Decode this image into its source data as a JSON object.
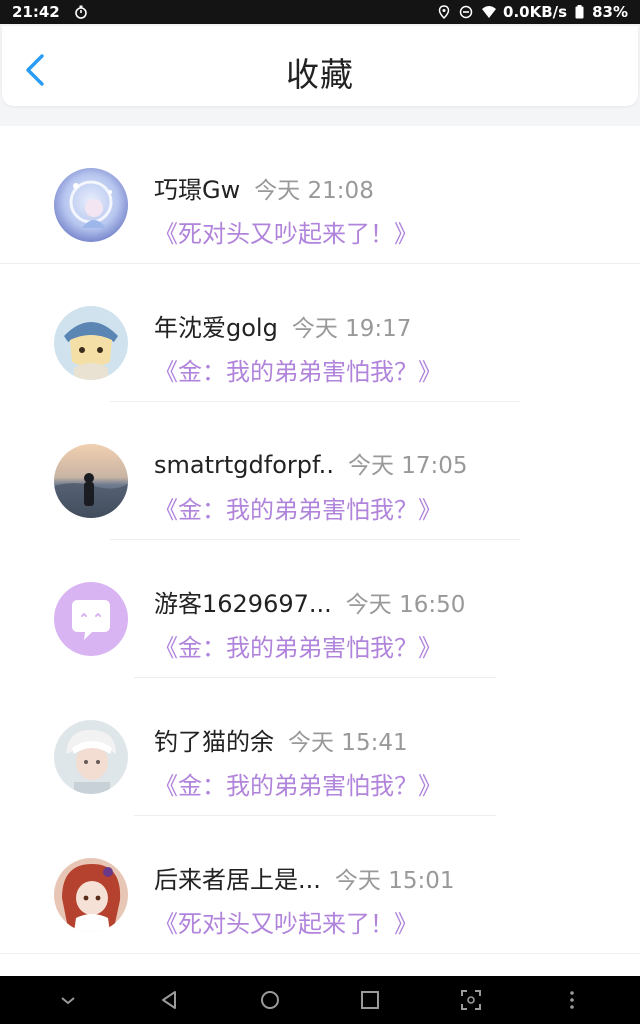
{
  "status_bar": {
    "time": "21:42",
    "net_speed": "0.0KB/s",
    "battery": "83%"
  },
  "header": {
    "title": "收藏"
  },
  "items": [
    {
      "name": "巧璟Gw",
      "time": "今天 21:08",
      "title": "《死对头又吵起来了！》"
    },
    {
      "name": "年沈爱golg",
      "time": "今天 19:17",
      "title": "《金：我的弟弟害怕我？》"
    },
    {
      "name": "smatrtgdforpf..",
      "time": "今天 17:05",
      "title": "《金：我的弟弟害怕我？》"
    },
    {
      "name": "游客1629697...",
      "time": "今天 16:50",
      "title": "《金：我的弟弟害怕我？》"
    },
    {
      "name": "钓了猫的余",
      "time": "今天 15:41",
      "title": "《金：我的弟弟害怕我？》"
    },
    {
      "name": "后来者居上是...",
      "time": "今天 15:01",
      "title": "《死对头又吵起来了！》"
    }
  ],
  "colors": {
    "accent_blue": "#2a9bf4",
    "title_purple": "#b184dc",
    "avatar_purple": "#d9b4f2"
  }
}
